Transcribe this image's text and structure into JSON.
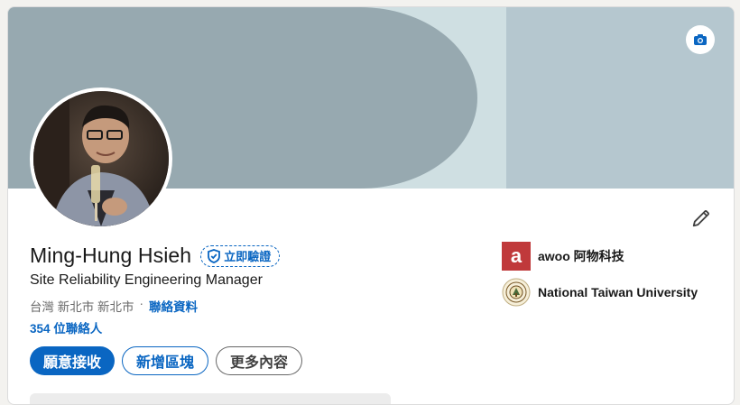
{
  "profile": {
    "name": "Ming-Hung Hsieh",
    "verify_label": "立即驗證",
    "headline": "Site Reliability Engineering Manager",
    "location": "台灣 新北市 新北市",
    "separator": "·",
    "contact_info_label": "聯絡資料",
    "connections": "354 位聯絡人"
  },
  "actions": {
    "open_to_label": "願意接收",
    "add_section_label": "新增區塊",
    "more_label": "更多內容"
  },
  "organizations": [
    {
      "name": "awoo 阿物科技",
      "logo_letter": "a",
      "icon": "awoo-logo"
    },
    {
      "name": "National Taiwan University",
      "icon": "ntu-seal-logo"
    }
  ],
  "icons": {
    "cover_edit": "camera-icon",
    "profile_edit": "pencil-icon",
    "verify": "shield-check-icon"
  },
  "colors": {
    "accent": "#0a66c2",
    "cover_dark": "#97a9b0",
    "cover_light": "#b5c7cf",
    "awoo_red": "#c0393b"
  }
}
